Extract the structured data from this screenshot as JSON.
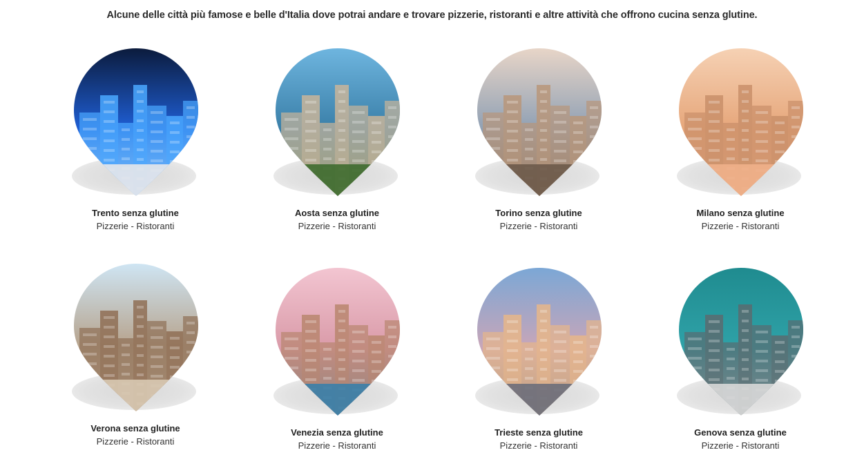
{
  "intro": "Alcune delle città più famose e belle d'Italia dove potrai andare e trovare pizzerie, ristoranti e altre attività che offrono cucina senza glutine.",
  "cities": [
    {
      "name": "Trento senza glutine",
      "sub": "Pizzerie - Ristoranti",
      "palette": [
        "#0b1a3a",
        "#1f5fd6",
        "#4aa8ff",
        "#e7e7ea"
      ]
    },
    {
      "name": "Aosta senza glutine",
      "sub": "Pizzerie - Ristoranti",
      "palette": [
        "#6fb6e0",
        "#3a7fa8",
        "#c9b59a",
        "#3e6b2f"
      ]
    },
    {
      "name": "Torino senza glutine",
      "sub": "Pizzerie - Ristoranti",
      "palette": [
        "#e9d6c8",
        "#8fa0b4",
        "#b8967a",
        "#6d5a4a"
      ]
    },
    {
      "name": "Milano senza glutine",
      "sub": "Pizzerie - Ristoranti",
      "palette": [
        "#f6d2b5",
        "#e6a67a",
        "#c98f6a",
        "#f0b08a"
      ]
    },
    {
      "name": "Verona senza glutine",
      "sub": "Pizzerie - Ristoranti",
      "palette": [
        "#cfe6f5",
        "#b7a48e",
        "#8f6f55",
        "#d8c9b3"
      ]
    },
    {
      "name": "Venezia senza glutine",
      "sub": "Pizzerie - Ristoranti",
      "palette": [
        "#f3c6d2",
        "#d99aa8",
        "#b8866f",
        "#3a7fa8"
      ]
    },
    {
      "name": "Trieste senza glutine",
      "sub": "Pizzerie - Ristoranti",
      "palette": [
        "#7aa7d6",
        "#c9a6b8",
        "#e6b68a",
        "#6b6e7a"
      ]
    },
    {
      "name": "Genova senza glutine",
      "sub": "Pizzerie - Ristoranti",
      "palette": [
        "#1f8b8f",
        "#2fa2a8",
        "#5a6b70",
        "#d8d8d8"
      ]
    }
  ]
}
